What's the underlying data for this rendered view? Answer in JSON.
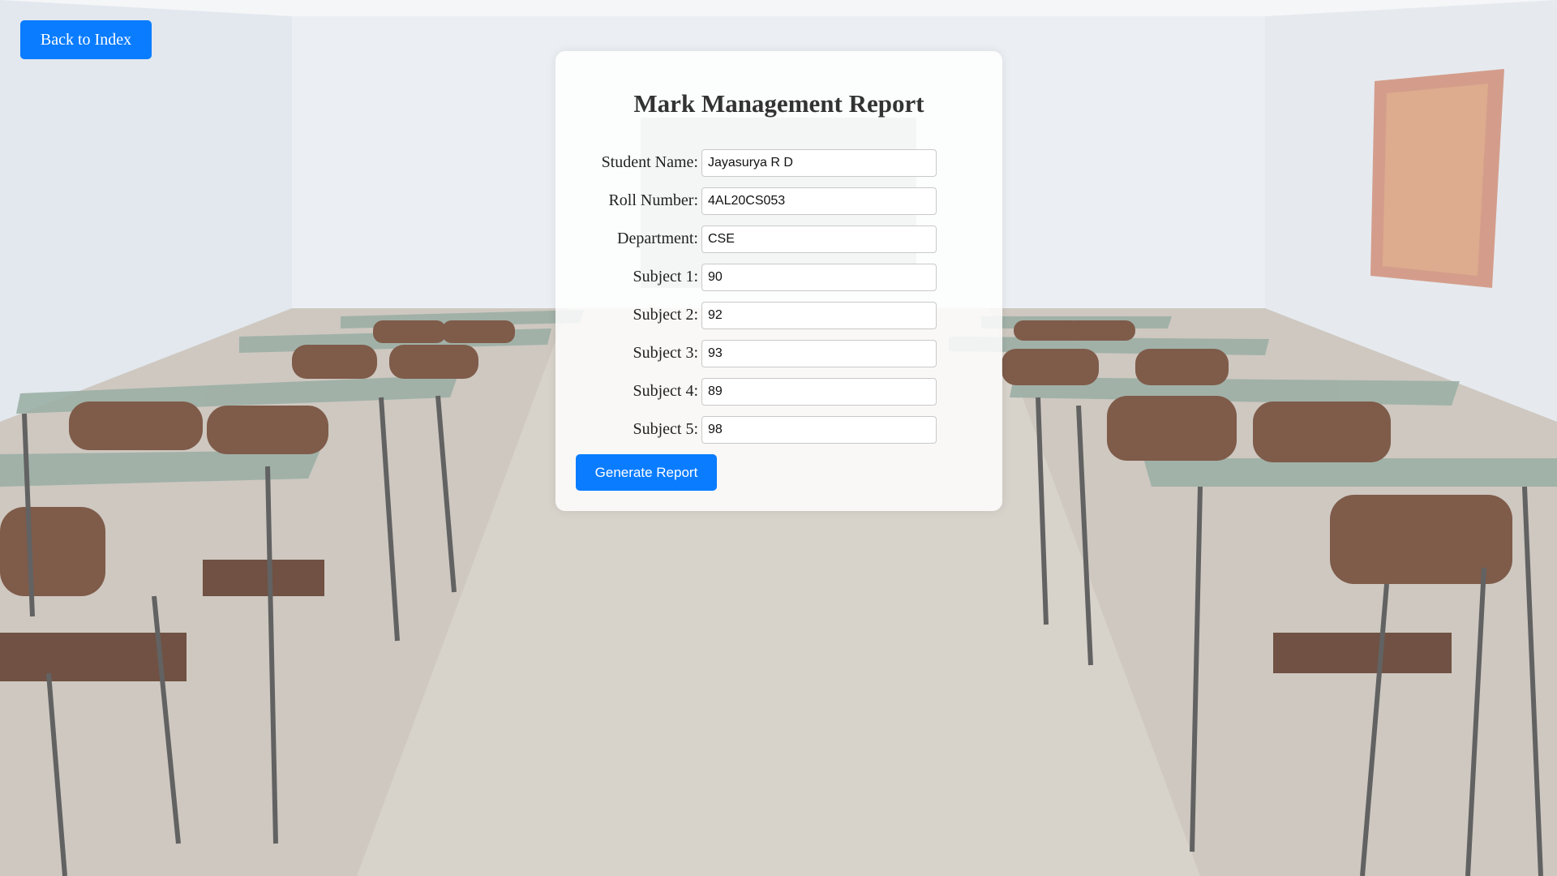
{
  "navigation": {
    "back_label": "Back to Index"
  },
  "form": {
    "title": "Mark Management Report",
    "fields": [
      {
        "label": "Student Name:",
        "value": "Jayasurya R D"
      },
      {
        "label": "Roll Number:",
        "value": "4AL20CS053"
      },
      {
        "label": "Department:",
        "value": "CSE"
      },
      {
        "label": "Subject 1:",
        "value": "90"
      },
      {
        "label": "Subject 2:",
        "value": "92"
      },
      {
        "label": "Subject 3:",
        "value": "93"
      },
      {
        "label": "Subject 4:",
        "value": "89"
      },
      {
        "label": "Subject 5:",
        "value": "98"
      }
    ],
    "submit_label": "Generate Report"
  },
  "colors": {
    "button_bg": "#0a7cff",
    "button_text": "#ffffff",
    "card_bg": "rgba(255,255,255,0.84)"
  }
}
